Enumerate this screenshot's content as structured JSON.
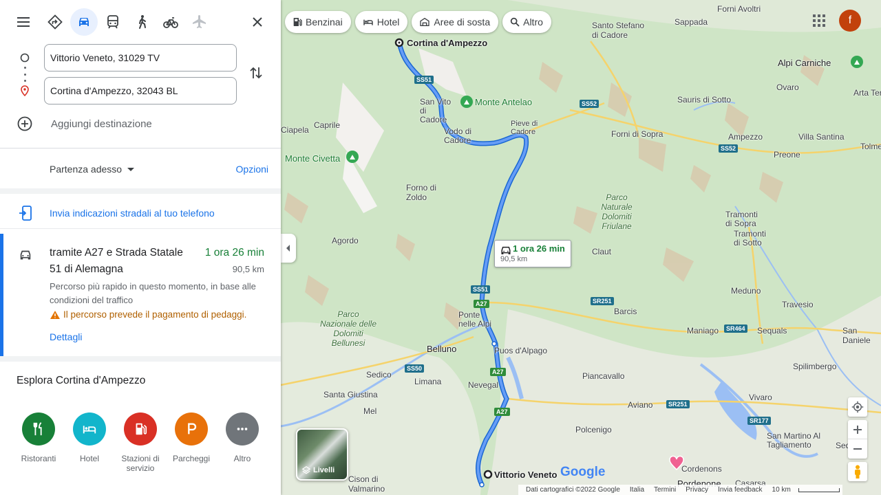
{
  "panel": {
    "modes": [
      "menu-icon",
      "best-route-icon",
      "car-icon",
      "transit-icon",
      "walk-icon",
      "bicycle-icon",
      "flight-icon"
    ],
    "origin_value": "Vittorio Veneto, 31029 TV",
    "destination_value": "Cortina d'Ampezzo, 32043 BL",
    "add_destination": "Aggiungi destinazione",
    "depart_label": "Partenza adesso",
    "options_label": "Opzioni",
    "send_to_phone": "Invia indicazioni stradali al tuo telefono",
    "route": {
      "title": "tramite A27 e Strada Statale 51 di Alemagna",
      "duration": "1 ora 26 min",
      "distance": "90,5 km",
      "description": "Percorso più rapido in questo momento, in base alle condizioni del traffico",
      "warning": "Il percorso prevede il pagamento di pedaggi.",
      "details_link": "Dettagli"
    },
    "explore": {
      "title": "Esplora Cortina d'Ampezzo",
      "items": [
        {
          "label": "Ristoranti",
          "color": "#188038",
          "icon": "restaurant-icon"
        },
        {
          "label": "Hotel",
          "color": "#12b5cb",
          "icon": "hotel-icon"
        },
        {
          "label": "Stazioni di servizio",
          "color": "#d93025",
          "icon": "gas-station-icon"
        },
        {
          "label": "Parcheggi",
          "color": "#e8710a",
          "icon": "parking-icon"
        },
        {
          "label": "Altro",
          "color": "#70757a",
          "icon": "more-icon"
        }
      ]
    }
  },
  "map": {
    "chips": [
      "Benzinai",
      "Hotel",
      "Aree di sosta",
      "Altro"
    ],
    "avatar_letter": "f",
    "bubble_time": "1 ora 26 min",
    "bubble_dist": "90,5 km",
    "layers_label": "Livelli",
    "start_label": "Vittorio Veneto",
    "end_label": "Cortina d'Ampezzo",
    "logo": "Google",
    "footer": [
      "Dati cartografici ©2022 Google",
      "Italia",
      "Termini",
      "Privacy",
      "Invia feedback",
      "10 km"
    ],
    "places": {
      "forni_avoltri": "Forni Avoltri",
      "santo_stefano": "Santo Stefano di Cadore",
      "sappada": "Sappada",
      "alpi_carniche": "Alpi Carniche",
      "ovaro": "Ovaro",
      "arta_terme": "Arta Terme",
      "san_vito": "San Vito di Cadore",
      "monte_antelao": "Monte Antelao",
      "sauris": "Sauris di Sotto",
      "caprile": "Caprile",
      "ciapela": "Ciapela",
      "vodo": "Vodo di Cadore",
      "pieve": "Pieve di Cadore",
      "forni_sopra": "Forni di Sopra",
      "ampezzo": "Ampezzo",
      "villa_santina": "Villa Santina",
      "tolmezzo": "Tolmezzo",
      "preone": "Preone",
      "monte_civetta": "Monte Civetta",
      "forno_zoldo": "Forno di Zoldo",
      "parco_friulane": "Parco Naturale Dolomiti Friulane",
      "tramonti_sopra": "Tramonti di Sopra",
      "tramonti_sotto": "Tramonti di Sotto",
      "agordo": "Agordo",
      "claut": "Claut",
      "meduno": "Meduno",
      "travesio": "Travesio",
      "parco_bellunesi": "Parco Nazionale delle Dolomiti Bellunesi",
      "ponte_alpi": "Ponte nelle Alpi",
      "barcis": "Barcis",
      "maniago": "Maniago",
      "sequals": "Sequals",
      "san_daniele": "San Daniele",
      "belluno": "Belluno",
      "puos": "Puos d'Alpago",
      "spilimbergo": "Spilimbergo",
      "sedico": "Sedico",
      "limana": "Limana",
      "piancavallo": "Piancavallo",
      "nevegal": "Nevegal",
      "santa_giustina": "Santa Giustina",
      "aviano": "Aviano",
      "vivaro": "Vivaro",
      "mel": "Mel",
      "polcenigo": "Polcenigo",
      "san_martino": "San Martino Al Tagliamento",
      "sedegl": "Sedeg",
      "cordenons": "Cordenons",
      "cison": "Cison di Valmarino",
      "pordenone": "Pordenone",
      "casarsa": "Casarsa"
    },
    "roads": {
      "ss51_a": "SS51",
      "ss51_b": "SS51",
      "ss52_a": "SS52",
      "ss52_b": "SS52",
      "a27_a": "A27",
      "a27_b": "A27",
      "a27_c": "A27",
      "ss50": "SS50",
      "sr251_a": "SR251",
      "sr251_b": "SR251",
      "sr464": "SR464",
      "sr177": "SR177"
    }
  }
}
